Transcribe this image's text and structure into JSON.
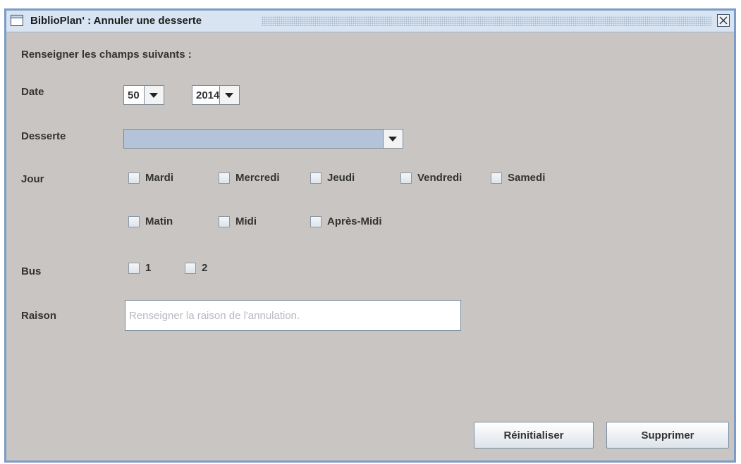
{
  "window": {
    "title": "BiblioPlan' : Annuler une desserte"
  },
  "form": {
    "intro": "Renseigner les champs suivants :",
    "date_label": "Date",
    "week_value": "50",
    "year_value": "2014",
    "desserte_label": "Desserte",
    "desserte_value": "",
    "jour_label": "Jour",
    "days": [
      "Mardi",
      "Mercredi",
      "Jeudi",
      "Vendredi",
      "Samedi"
    ],
    "periods": [
      "Matin",
      "Midi",
      "Après-Midi"
    ],
    "bus_label": "Bus",
    "buses": [
      "1",
      "2"
    ],
    "raison_label": "Raison",
    "raison_placeholder": "Renseigner la raison de l'annulation.",
    "raison_value": ""
  },
  "buttons": {
    "reset": "Réinitialiser",
    "delete": "Supprimer"
  },
  "icons": {
    "window": "window-icon",
    "close": "close-icon",
    "dropdown": "chevron-down-icon"
  }
}
